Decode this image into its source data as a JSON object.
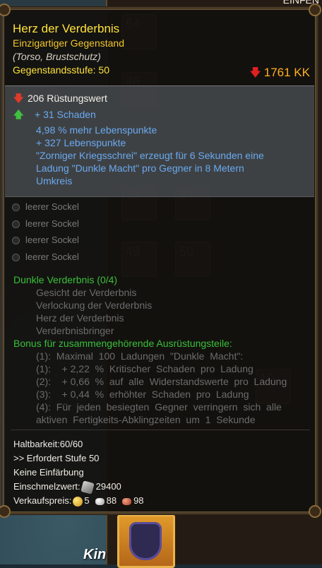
{
  "background": {
    "top_right_text": "EINFEN",
    "inventory_numbers": [
      "54",
      "46",
      "49",
      "54",
      "49",
      "50",
      "10"
    ],
    "character_name": "Kin"
  },
  "tooltip": {
    "name": "Herz der Verderbnis",
    "rarity": "Einzigartiger Gegenstand",
    "slot": "(Torso, Brustschutz)",
    "item_level": "Gegenstandsstufe: 50",
    "price": "1761 KK",
    "stats": {
      "armor": "206 Rüstungswert",
      "damage": "+ 31 Schaden",
      "extra": [
        "4,98 % mehr Lebenspunkte",
        "+ 327 Lebenspunkte",
        "\"Zorniger Kriegsschrei\" erzeugt für 6 Sekunden eine",
        "Ladung \"Dunkle Macht\" pro Gegner in 8 Metern",
        "Umkreis"
      ]
    },
    "sockets": [
      "leerer Sockel",
      "leerer Sockel",
      "leerer Sockel",
      "leerer Sockel"
    ],
    "set": {
      "title": "Dunkle Verderbnis (0/4)",
      "items": [
        "Gesicht der Verderbnis",
        "Verlockung der Verderbnis",
        "Herz der Verderbnis",
        "Verderbnisbringer"
      ],
      "bonus_title": "Bonus für zusammengehörende Ausrüstungsteile:",
      "bonuses": [
        "(1):  Maximal  100  Ladungen  \"Dunkle  Macht\":",
        "(1):    + 2,22  %  Kritischer  Schaden  pro  Ladung",
        "(2):    + 0,66  %  auf  alle  Widerstandswerte  pro  Ladung",
        "(3):    + 0,44  %  erhöhter  Schaden  pro  Ladung",
        "(4):  Für  jeden  besiegten  Gegner  verringern  sich  alle",
        "aktiven  Fertigkeits-Abklingzeiten  um  1  Sekunde"
      ]
    },
    "footer": {
      "durability": "Haltbarkeit:60/60",
      "requires": ">> Erfordert Stufe 50",
      "dye": "Keine Einfärbung",
      "smelt_label": "Einschmelzwert:",
      "smelt_value": "29400",
      "sell_label": "Verkaufspreis:",
      "gold": "5",
      "silver": "88",
      "copper": "98"
    }
  }
}
